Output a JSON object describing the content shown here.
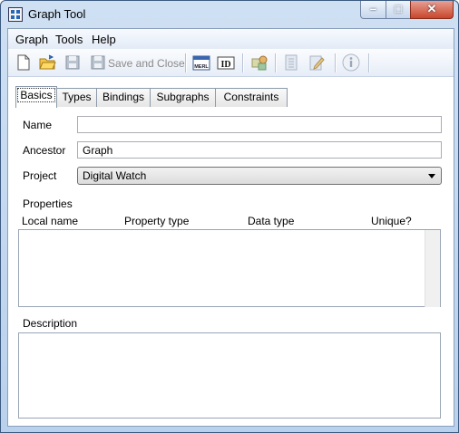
{
  "window": {
    "title": "Graph Tool"
  },
  "menu": {
    "items": [
      {
        "label": "Graph"
      },
      {
        "label": "Tools"
      },
      {
        "label": "Help"
      }
    ]
  },
  "toolbar": {
    "save_close_label": "Save and Close",
    "merl_label": "MERL",
    "id_label": "ID"
  },
  "tabs": [
    {
      "label": "Basics"
    },
    {
      "label": "Types"
    },
    {
      "label": "Bindings"
    },
    {
      "label": "Subgraphs"
    },
    {
      "label": "Constraints"
    }
  ],
  "form": {
    "name_label": "Name",
    "name_value": "",
    "ancestor_label": "Ancestor",
    "ancestor_value": "Graph",
    "project_label": "Project",
    "project_value": "Digital Watch",
    "properties_label": "Properties",
    "columns": [
      "Local name",
      "Property type",
      "Data type",
      "Unique?"
    ],
    "description_label": "Description"
  },
  "icons": [
    "new-icon",
    "open-icon",
    "save-icon",
    "save-close-icon",
    "merl-icon",
    "id-icon",
    "graph-icon",
    "list-icon",
    "edit-icon",
    "info-icon"
  ]
}
